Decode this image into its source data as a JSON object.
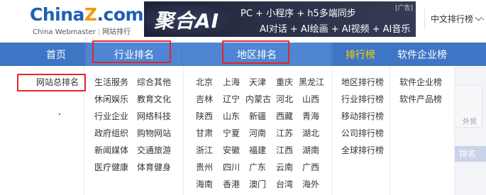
{
  "header": {
    "logo": {
      "part1": "China",
      "part2": "Z",
      "part3": ".com",
      "subtitle_en": "China Webmaster",
      "subtitle_cn": "网站排行"
    },
    "banner": {
      "title": "聚合AI",
      "line1": "PC + 小程序 + h5多端同步",
      "line2": "AI对话 + AI绘画 + AI视频 + AI音乐",
      "ad_label": "[广告]"
    },
    "language_select": {
      "value": "中文排行榜"
    }
  },
  "nav": {
    "home": "首页",
    "industry": "行业排名",
    "region": "地区排名",
    "rank_list": "排行榜",
    "software": "软件企业榜"
  },
  "panel": {
    "home_items": [
      "网站总排名"
    ],
    "industry_col1": [
      "生活服务",
      "休闲娱乐",
      "行业企业",
      "政府组织",
      "新闻媒体",
      "医疗健康"
    ],
    "industry_col2": [
      "综合其他",
      "教育文化",
      "网络科技",
      "购物网站",
      "交通旅游",
      "体育健身"
    ],
    "regions": [
      [
        "北京",
        "上海",
        "天津",
        "重庆",
        "黑龙江"
      ],
      [
        "吉林",
        "辽宁",
        "内蒙古",
        "河北",
        "山西"
      ],
      [
        "陕西",
        "山东",
        "新疆",
        "西藏",
        "青海"
      ],
      [
        "甘肃",
        "宁夏",
        "河南",
        "江苏",
        "湖北"
      ],
      [
        "浙江",
        "安徽",
        "福建",
        "江西",
        "湖南"
      ],
      [
        "贵州",
        "四川",
        "广东",
        "云南",
        "广西"
      ],
      [
        "海南",
        "香港",
        "澳门",
        "台湾",
        "海外"
      ]
    ],
    "rank_items": [
      "地区排行榜",
      "行业排行榜",
      "移动排行榜",
      "公司排行榜",
      "全球排行榜"
    ],
    "software_items": [
      "软件企业榜",
      "软件产品榜"
    ]
  },
  "background_fragments": {
    "text": "外贸",
    "button": "排名"
  },
  "colors": {
    "nav_bg": "#3e75c4",
    "nav_active_bg": "#4f85d2",
    "highlight": "#ffd100",
    "annotation_red": "#e3262b",
    "logo_blue": "#1e5fb4",
    "logo_orange": "#f39800"
  }
}
